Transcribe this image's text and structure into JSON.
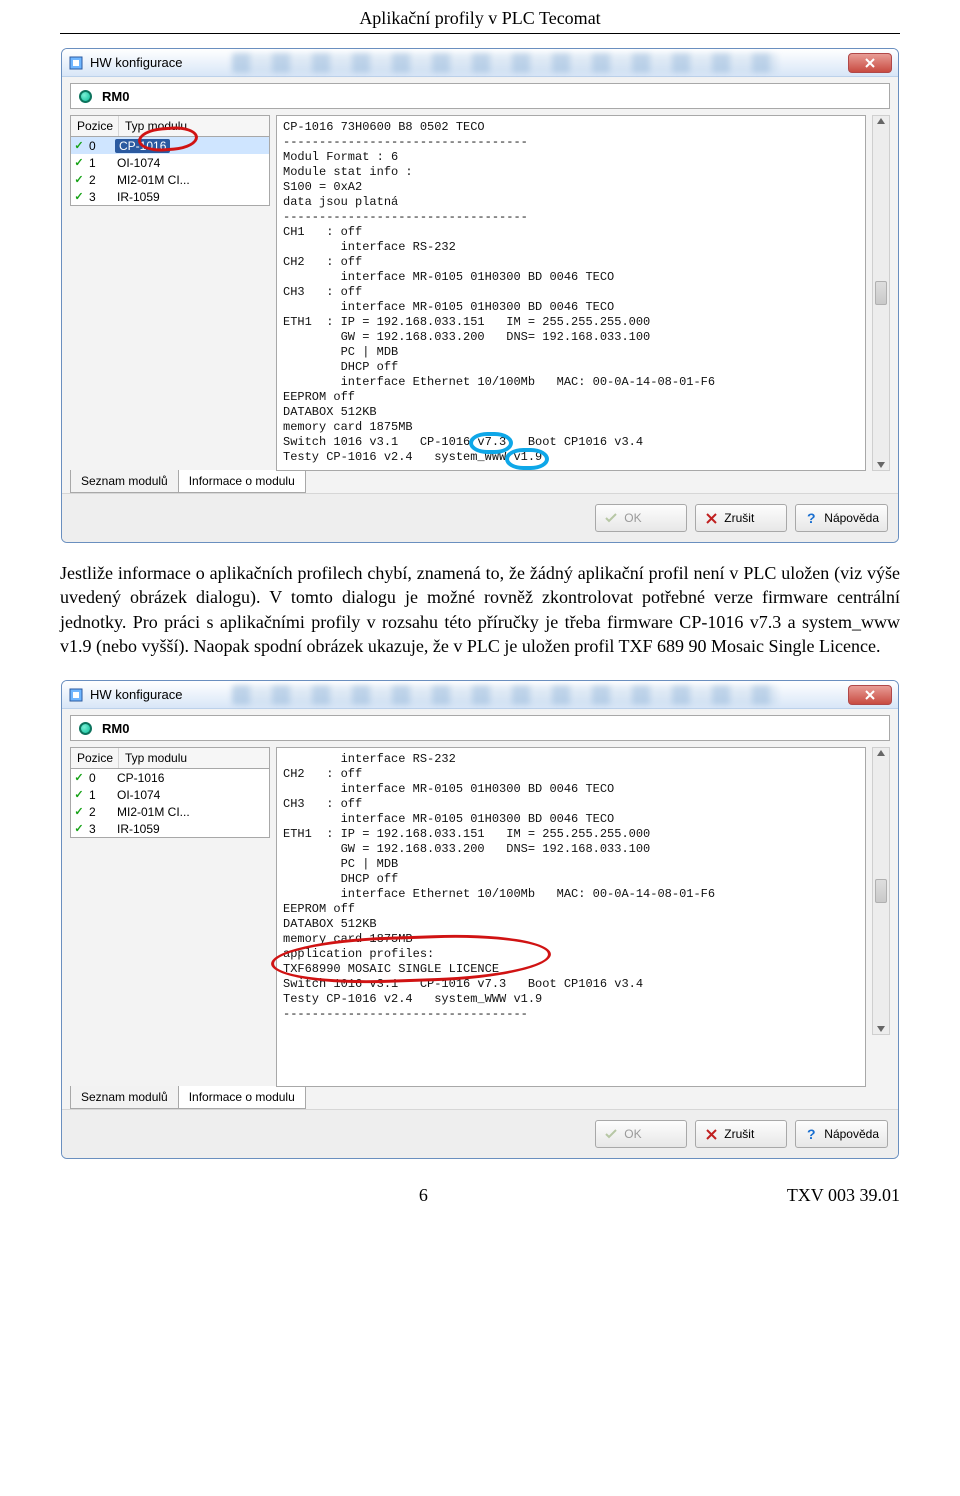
{
  "page": {
    "header": "Aplikační profily v PLC Tecomat",
    "page_num": "6",
    "doc_id": "TXV 003 39.01"
  },
  "paragraph": "Jestliže informace o aplikačních profilech chybí, znamená to, že žádný aplikační profil není v PLC uložen (viz výše uvedený obrázek dialogu). V tomto dialogu je možné rovněž zkontrolovat potřebné verze firmware centrální jednotky. Pro práci s aplikačními profily v rozsahu této příručky je třeba firmware CP-1016 v7.3 a system_www v1.9 (nebo vyšší). Naopak spodní obrázek ukazuje, že v PLC je uložen profil TXF 689 90 Mosaic Single Licence.",
  "dialog": {
    "title": "HW konfigurace",
    "rack": "RM0",
    "col_pos": "Pozice",
    "col_mod": "Typ modulu",
    "rows": [
      {
        "pos": "0",
        "mod": "CP-1016"
      },
      {
        "pos": "1",
        "mod": "OI-1074"
      },
      {
        "pos": "2",
        "mod": "MI2-01M CI..."
      },
      {
        "pos": "3",
        "mod": "IR-1059"
      }
    ],
    "tab1": "Seznam modulů",
    "tab2": "Informace o modulu",
    "btn_ok": "OK",
    "btn_cancel": "Zrušit",
    "btn_help": "Nápověda"
  },
  "info1": {
    "lines": [
      "CP-1016 73H0600 B8 0502 TECO",
      "----------------------------------",
      "Modul Format : 6",
      "Module stat info :",
      "S100 = 0xA2",
      "data jsou platná",
      "----------------------------------",
      "CH1   : off",
      "        interface RS-232",
      "CH2   : off",
      "        interface MR-0105 01H0300 BD 0046 TECO",
      "CH3   : off",
      "        interface MR-0105 01H0300 BD 0046 TECO",
      "ETH1  : IP = 192.168.033.151   IM = 255.255.255.000",
      "        GW = 192.168.033.200   DNS= 192.168.033.100",
      "        PC | MDB",
      "        DHCP off",
      "        interface Ethernet 10/100Mb   MAC: 00-0A-14-08-01-F6",
      "EEPROM off",
      "DATABOX 512KB",
      "memory card 1875MB",
      "Switch 1016 v3.1   CP-1016 v7.3   Boot CP1016 v3.4",
      "Testy CP-1016 v2.4   system_WWW v1.9"
    ]
  },
  "info2": {
    "lines": [
      "        interface RS-232",
      "CH2   : off",
      "        interface MR-0105 01H0300 BD 0046 TECO",
      "CH3   : off",
      "        interface MR-0105 01H0300 BD 0046 TECO",
      "ETH1  : IP = 192.168.033.151   IM = 255.255.255.000",
      "        GW = 192.168.033.200   DNS= 192.168.033.100",
      "        PC | MDB",
      "        DHCP off",
      "        interface Ethernet 10/100Mb   MAC: 00-0A-14-08-01-F6",
      "EEPROM off",
      "DATABOX 512KB",
      "memory card 1875MB",
      "application profiles:",
      "TXF68990 MOSAIC SINGLE LICENCE",
      "Switch 1016 v3.1   CP-1016 v7.3   Boot CP1016 v3.4",
      "Testy CP-1016 v2.4   system_WWW v1.9",
      "----------------------------------"
    ]
  }
}
